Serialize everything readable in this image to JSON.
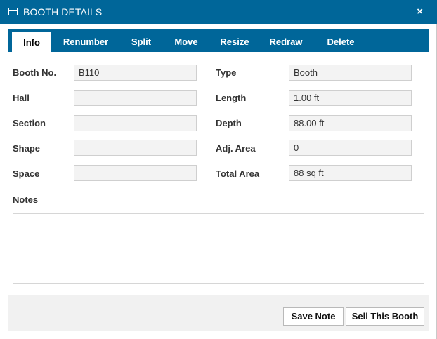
{
  "dialog": {
    "title": "BOOTH DETAILS",
    "close_label": "×"
  },
  "tabs": [
    {
      "label": "Info",
      "active": true
    },
    {
      "label": "Renumber"
    },
    {
      "label": "Split"
    },
    {
      "label": "Move"
    },
    {
      "label": "Resize"
    },
    {
      "label": "Redraw"
    },
    {
      "label": "Delete"
    }
  ],
  "fields": {
    "booth_no": {
      "label": "Booth No.",
      "value": "B110"
    },
    "hall": {
      "label": "Hall",
      "value": ""
    },
    "section": {
      "label": "Section",
      "value": ""
    },
    "shape": {
      "label": "Shape",
      "value": ""
    },
    "space": {
      "label": "Space",
      "value": ""
    },
    "type": {
      "label": "Type",
      "value": "Booth"
    },
    "length": {
      "label": "Length",
      "value": "1.00 ft"
    },
    "depth": {
      "label": "Depth",
      "value": "88.00 ft"
    },
    "adj_area": {
      "label": "Adj. Area",
      "value": "0"
    },
    "total_area": {
      "label": "Total Area",
      "value": "88 sq ft"
    }
  },
  "notes": {
    "label": "Notes",
    "value": ""
  },
  "buttons": {
    "save_note": "Save Note",
    "sell_booth": "Sell This Booth"
  },
  "colors": {
    "header_blue": "#006699",
    "footer_gray": "#f1f1f1"
  }
}
